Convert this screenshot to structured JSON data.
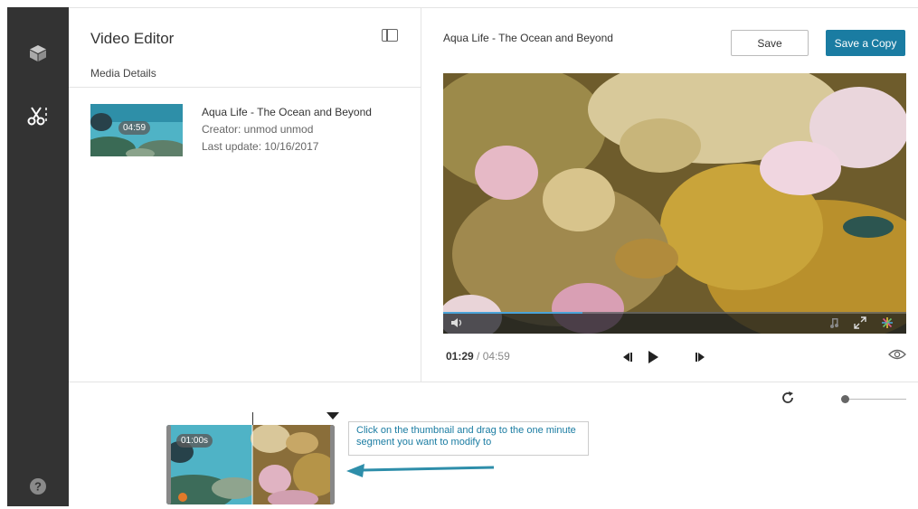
{
  "sidebar": {
    "items": [
      {
        "icon": "cube-icon"
      },
      {
        "icon": "scissors-icon",
        "active": true
      },
      {
        "icon": "help-icon"
      }
    ]
  },
  "editor": {
    "title": "Video Editor",
    "subtitle": "Media Details"
  },
  "media": {
    "thumb_duration": "04:59",
    "title": "Aqua Life - The Ocean and Beyond",
    "creator": "Creator: unmod unmod",
    "last_update": "Last update: 10/16/2017"
  },
  "player": {
    "title": "Aqua Life - The Ocean and Beyond",
    "save_label": "Save",
    "save_copy_label": "Save a Copy",
    "current_time": "01:29",
    "separator": "/",
    "total_time": "04:59",
    "progress_fraction": 0.3
  },
  "timeline": {
    "segment_label": "01:00s",
    "hint": "Click on the thumbnail and drag to the one minute segment you want to modify to",
    "zoom_fraction": 0.0
  },
  "colors": {
    "sidebar_bg": "#333333",
    "accent": "#1a7ca2"
  }
}
